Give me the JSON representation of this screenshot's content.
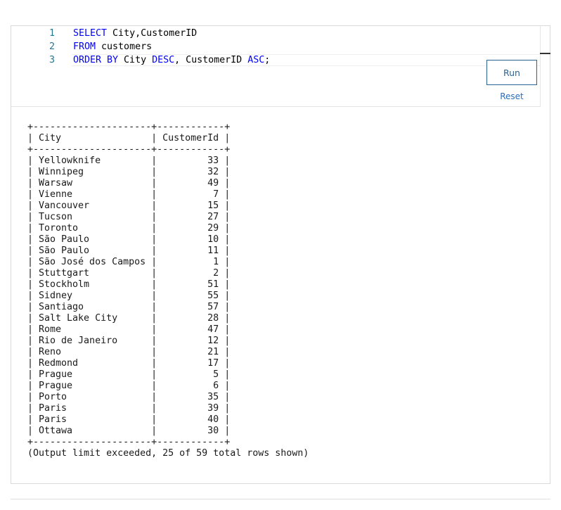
{
  "editor": {
    "lines": [
      {
        "number": "1",
        "tokens": [
          {
            "text": "SELECT",
            "kind": "kw"
          },
          {
            "text": " City,CustomerID",
            "kind": "id"
          }
        ]
      },
      {
        "number": "2",
        "tokens": [
          {
            "text": "FROM",
            "kind": "kw"
          },
          {
            "text": " customers",
            "kind": "id"
          }
        ]
      },
      {
        "number": "3",
        "tokens": [
          {
            "text": "ORDER BY",
            "kind": "kw"
          },
          {
            "text": " City ",
            "kind": "id"
          },
          {
            "text": "DESC",
            "kind": "kw"
          },
          {
            "text": ", CustomerID ",
            "kind": "id"
          },
          {
            "text": "ASC",
            "kind": "kw"
          },
          {
            "text": ";",
            "kind": "punct"
          }
        ]
      }
    ]
  },
  "controls": {
    "run_label": "Run",
    "reset_label": "Reset"
  },
  "result": {
    "columns": [
      "City",
      "CustomerId"
    ],
    "rows": [
      [
        "Yellowknife",
        "33"
      ],
      [
        "Winnipeg",
        "32"
      ],
      [
        "Warsaw",
        "49"
      ],
      [
        "Vienne",
        "7"
      ],
      [
        "Vancouver",
        "15"
      ],
      [
        "Tucson",
        "27"
      ],
      [
        "Toronto",
        "29"
      ],
      [
        "São Paulo",
        "10"
      ],
      [
        "São Paulo",
        "11"
      ],
      [
        "São José dos Campos",
        "1"
      ],
      [
        "Stuttgart",
        "2"
      ],
      [
        "Stockholm",
        "51"
      ],
      [
        "Sidney",
        "55"
      ],
      [
        "Santiago",
        "57"
      ],
      [
        "Salt Lake City",
        "28"
      ],
      [
        "Rome",
        "47"
      ],
      [
        "Rio de Janeiro",
        "12"
      ],
      [
        "Reno",
        "21"
      ],
      [
        "Redmond",
        "17"
      ],
      [
        "Prague",
        "5"
      ],
      [
        "Prague",
        "6"
      ],
      [
        "Porto",
        "35"
      ],
      [
        "Paris",
        "39"
      ],
      [
        "Paris",
        "40"
      ],
      [
        "Ottawa",
        "30"
      ]
    ],
    "note": "(Output limit exceeded, 25 of 59 total rows shown)"
  },
  "colors": {
    "keyword": "#0000ff",
    "line_number": "#237893",
    "button_border": "#2a6496",
    "link": "#2a6ebb"
  }
}
